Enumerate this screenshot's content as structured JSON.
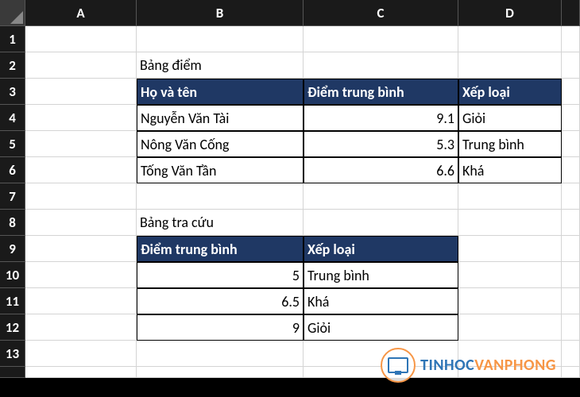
{
  "columns": [
    "A",
    "B",
    "C",
    "D"
  ],
  "rowCount": 14,
  "table1": {
    "title": "Bảng điểm",
    "headers": [
      "Họ và tên",
      "Điểm trung bình",
      "Xếp loại"
    ],
    "rows": [
      {
        "name": "Nguyễn Văn Tài",
        "score": "9.1",
        "rank": "Giỏi"
      },
      {
        "name": "Nông Văn Cống",
        "score": "5.3",
        "rank": "Trung bình"
      },
      {
        "name": "Tống Văn Tần",
        "score": "6.6",
        "rank": "Khá"
      }
    ]
  },
  "table2": {
    "title": "Bảng tra cứu",
    "headers": [
      "Điểm trung bình",
      "Xếp loại"
    ],
    "rows": [
      {
        "threshold": "5",
        "rank": "Trung bình"
      },
      {
        "threshold": "6.5",
        "rank": "Khá"
      },
      {
        "threshold": "9",
        "rank": "Giỏi"
      }
    ]
  },
  "watermark": {
    "text1": "TINHOC",
    "text2": "VANPHONG"
  }
}
